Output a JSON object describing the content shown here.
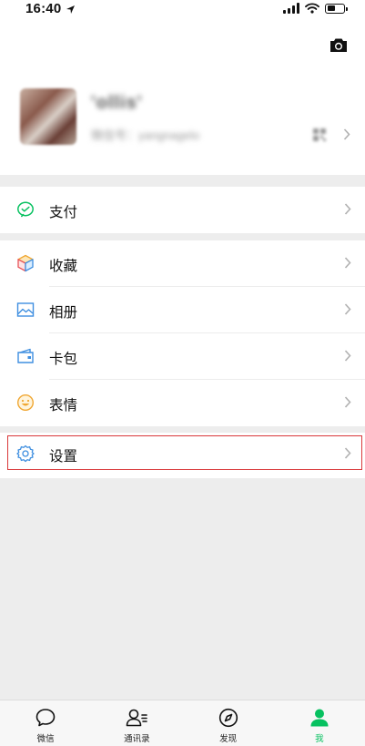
{
  "status_bar": {
    "time": "16:40"
  },
  "profile": {
    "nickname": "'ollis'",
    "wechat_id": "微信号：yangnagelo"
  },
  "menu": {
    "pay": {
      "label": "支付",
      "icon": "wechat-pay-icon"
    },
    "favorites": {
      "label": "收藏",
      "icon": "cube-icon"
    },
    "album": {
      "label": "相册",
      "icon": "image-icon"
    },
    "cards": {
      "label": "卡包",
      "icon": "wallet-icon"
    },
    "stickers": {
      "label": "表情",
      "icon": "smiley-icon"
    },
    "settings": {
      "label": "设置",
      "icon": "gear-icon"
    }
  },
  "tabs": [
    {
      "label": "微信",
      "icon": "chat-bubble-icon",
      "active": false
    },
    {
      "label": "通讯录",
      "icon": "contacts-icon",
      "active": false
    },
    {
      "label": "发现",
      "icon": "compass-icon",
      "active": false
    },
    {
      "label": "我",
      "icon": "person-icon",
      "active": true
    }
  ],
  "colors": {
    "accent_green": "#07c160",
    "highlight_red": "#d9383a",
    "background": "#ededed"
  }
}
